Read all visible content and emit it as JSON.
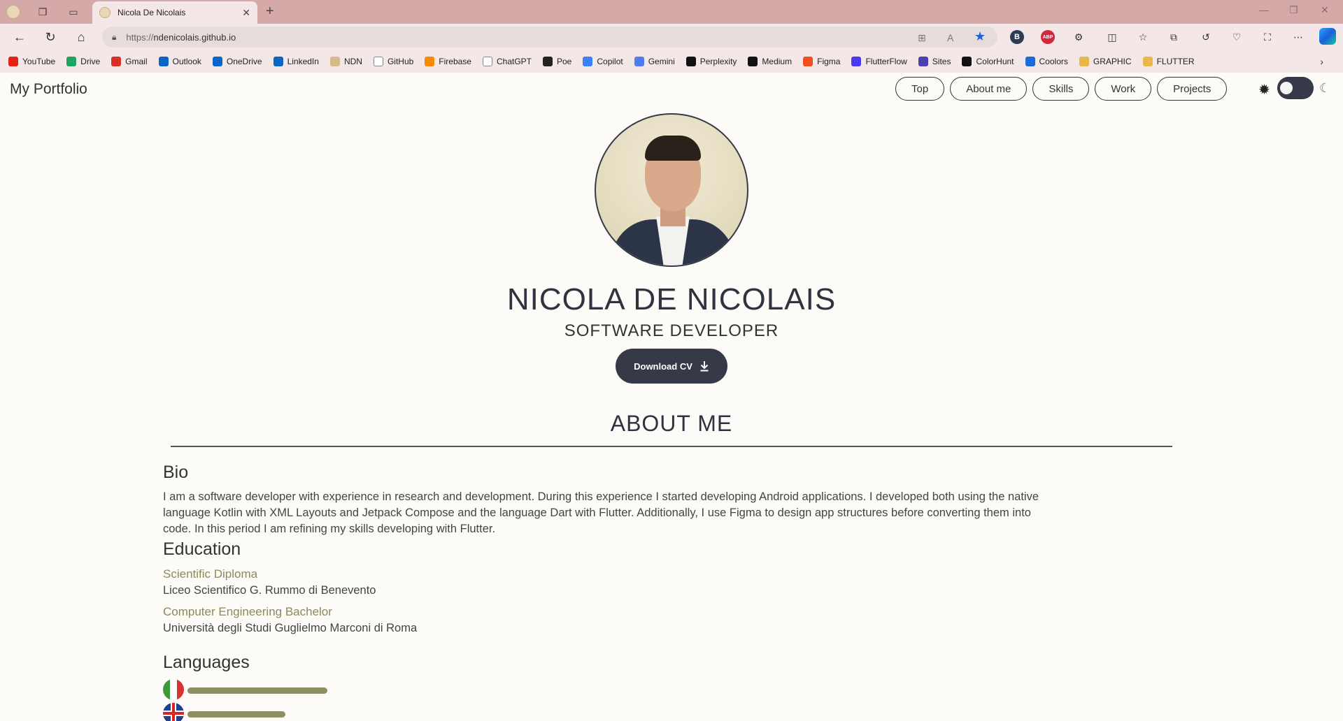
{
  "browser": {
    "tab_title": "Nicola De Nicolais",
    "url_protocol": "https://",
    "url_host": "ndenicolais.github.io",
    "bookmarks": [
      {
        "label": "YouTube",
        "icon": "youtube-icon",
        "color": "#e62117"
      },
      {
        "label": "Drive",
        "icon": "drive-icon",
        "color": "#1fa463"
      },
      {
        "label": "Gmail",
        "icon": "gmail-icon",
        "color": "#d93025"
      },
      {
        "label": "Outlook",
        "icon": "outlook-icon",
        "color": "#0a64c8"
      },
      {
        "label": "OneDrive",
        "icon": "onedrive-icon",
        "color": "#0a64c8"
      },
      {
        "label": "LinkedIn",
        "icon": "linkedin-icon",
        "color": "#0a66c2"
      },
      {
        "label": "NDN",
        "icon": "ndn-icon",
        "color": "#d4b98a"
      },
      {
        "label": "GitHub",
        "icon": "github-icon",
        "color": "#ffffff"
      },
      {
        "label": "Firebase",
        "icon": "firebase-icon",
        "color": "#f58a07"
      },
      {
        "label": "ChatGPT",
        "icon": "chatgpt-icon",
        "color": "#ffffff"
      },
      {
        "label": "Poe",
        "icon": "poe-icon",
        "color": "#222222"
      },
      {
        "label": "Copilot",
        "icon": "copilot-icon",
        "color": "#3b82f6"
      },
      {
        "label": "Gemini",
        "icon": "gemini-icon",
        "color": "#4f7df0"
      },
      {
        "label": "Perplexity",
        "icon": "perplexity-icon",
        "color": "#111111"
      },
      {
        "label": "Medium",
        "icon": "medium-icon",
        "color": "#111111"
      },
      {
        "label": "Figma",
        "icon": "figma-icon",
        "color": "#f24e1e"
      },
      {
        "label": "FlutterFlow",
        "icon": "flutterflow-icon",
        "color": "#4b39ef"
      },
      {
        "label": "Sites",
        "icon": "sites-icon",
        "color": "#4c3fb0"
      },
      {
        "label": "ColorHunt",
        "icon": "colorhunt-icon",
        "color": "#111111"
      },
      {
        "label": "Coolors",
        "icon": "coolors-icon",
        "color": "#1c6bd8"
      },
      {
        "label": "GRAPHIC",
        "icon": "folder-icon",
        "color": "#e8b74a"
      },
      {
        "label": "FLUTTER",
        "icon": "folder-icon",
        "color": "#e8b74a"
      }
    ]
  },
  "site": {
    "brand": "My Portfolio",
    "nav": [
      "Top",
      "About me",
      "Skills",
      "Work",
      "Projects"
    ],
    "theme_toggle": {
      "mode": "dark",
      "sun_icon": "sun-icon",
      "moon_icon": "moon-icon"
    },
    "hero": {
      "name": "NICOLA DE NICOLAIS",
      "role": "SOFTWARE DEVELOPER",
      "cv_label": "Download CV",
      "cv_icon": "download-icon"
    },
    "about": {
      "heading": "ABOUT ME",
      "bio_heading": "Bio",
      "bio_lines": [
        "I am a software developer with experience in research and development. During this experience I started developing Android applications. I developed both using the native",
        "language Kotlin with XML Layouts and Jetpack Compose and the language Dart with Flutter. Additionally, I use Figma to design app structures before converting them into",
        "code. In this period I am refining my skills developing with Flutter."
      ],
      "education_heading": "Education",
      "education": [
        {
          "degree": "Scientific Diploma",
          "school": "Liceo Scientifico G. Rummo di Benevento"
        },
        {
          "degree": "Computer Engineering Bachelor",
          "school": "Università degli Studi Guglielmo Marconi di Roma"
        }
      ],
      "languages_heading": "Languages",
      "languages": [
        {
          "flag": "italy-flag-icon",
          "level": 1.0
        },
        {
          "flag": "uk-flag-icon",
          "level": 0.7
        }
      ]
    }
  },
  "colors": {
    "accent": "#363a48",
    "degree_text": "#8a8a5c",
    "language_bar": "#8d8f63",
    "page_bg": "#fdfbf7",
    "browser_chrome": "#f3e7e7"
  }
}
